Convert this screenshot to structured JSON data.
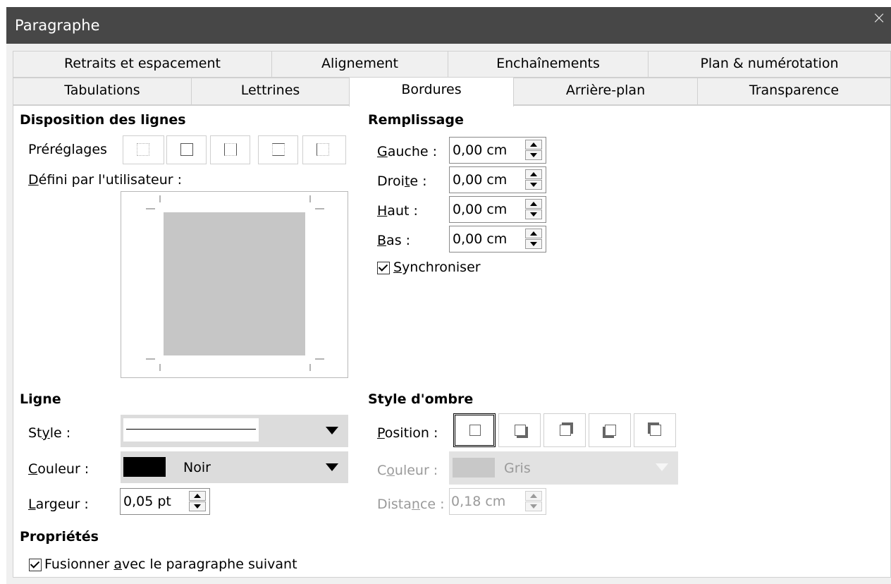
{
  "window": {
    "title": "Paragraphe",
    "close": "×"
  },
  "tabs": {
    "row1": [
      "Retraits et espacement",
      "Alignement",
      "Enchaînements",
      "Plan & numérotation"
    ],
    "row2": [
      "Tabulations",
      "Lettrines",
      "Bordures",
      "Arrière-plan",
      "Transparence"
    ],
    "active": "Bordures"
  },
  "disposition": {
    "heading": "Disposition des lignes",
    "presets_label": "Préréglages",
    "user_defined_label": "Défini par l'utilisateur :"
  },
  "remplissage": {
    "heading": "Remplissage",
    "fields": [
      {
        "label": "Gauche :",
        "value": "0,00 cm"
      },
      {
        "label": "Droite :",
        "value": "0,00 cm"
      },
      {
        "label": "Haut :",
        "value": "0,00 cm"
      },
      {
        "label": "Bas :",
        "value": "0,00 cm"
      }
    ],
    "sync_label": "Synchroniser",
    "sync_checked": true
  },
  "ligne": {
    "heading": "Ligne",
    "style_label": "Style :",
    "color_label": "Couleur :",
    "color_value": "Noir",
    "color_swatch": "#000000",
    "width_label": "Largeur :",
    "width_value": "0,05 pt"
  },
  "ombre": {
    "heading": "Style d'ombre",
    "position_label": "Position :",
    "color_label": "Couleur :",
    "color_value": "Gris",
    "color_swatch": "#c8c8c8",
    "distance_label": "Distance :",
    "distance_value": "0,18 cm"
  },
  "proprietes": {
    "heading": "Propriétés",
    "merge_label": "Fusionner avec le paragraphe suivant",
    "merge_checked": true
  }
}
